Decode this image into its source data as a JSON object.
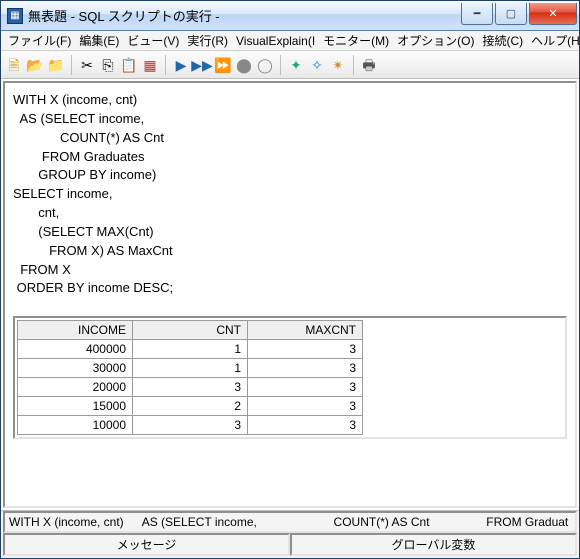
{
  "window": {
    "title": "無表題 - SQL スクリプトの実行 -"
  },
  "menu": {
    "file": "ファイル(F)",
    "edit": "編集(E)",
    "view": "ビュー(V)",
    "run": "実行(R)",
    "visual": "VisualExplain(I",
    "monitor": "モニター(M)",
    "options": "オプション(O)",
    "connect": "接続(C)",
    "help": "ヘルプ(H)"
  },
  "sql_text": "WITH X (income, cnt)\n  AS (SELECT income,\n             COUNT(*) AS Cnt\n        FROM Graduates\n       GROUP BY income)\nSELECT income,\n       cnt,\n       (SELECT MAX(Cnt)\n          FROM X) AS MaxCnt\n  FROM X\n ORDER BY income DESC;",
  "results": {
    "columns": [
      "INCOME",
      "CNT",
      "MAXCNT"
    ],
    "rows": [
      {
        "income": "400000",
        "cnt": "1",
        "maxcnt": "3"
      },
      {
        "income": "30000",
        "cnt": "1",
        "maxcnt": "3"
      },
      {
        "income": "20000",
        "cnt": "3",
        "maxcnt": "3"
      },
      {
        "income": "15000",
        "cnt": "2",
        "maxcnt": "3"
      },
      {
        "income": "10000",
        "cnt": "3",
        "maxcnt": "3"
      }
    ]
  },
  "status": {
    "s1": "WITH X (income, cnt)",
    "s2": "AS (SELECT income,",
    "s3": "COUNT(*) AS Cnt",
    "s4": "FROM Graduat",
    "tab1": "メッセージ",
    "tab2": "グローバル変数"
  }
}
